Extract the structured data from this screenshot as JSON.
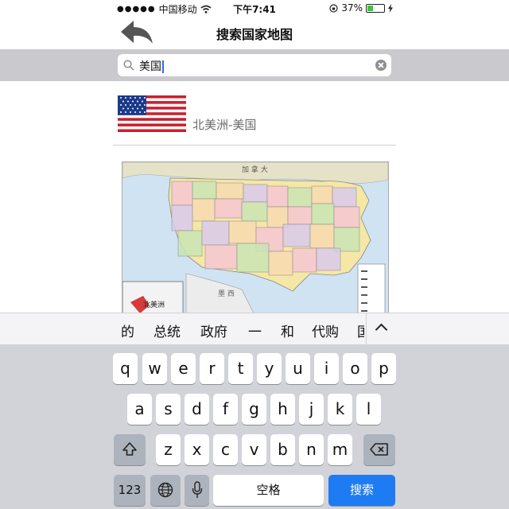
{
  "status": {
    "signal_dots": "●●●●●",
    "carrier": "中国移动",
    "time": "下午7:41",
    "battery": "37%",
    "battery_level": 0.37
  },
  "nav": {
    "title": "搜索国家地图"
  },
  "search": {
    "value": "美国"
  },
  "result": {
    "label": "北美洲-美国"
  },
  "map": {
    "labels": {
      "canada": "加 拿 大",
      "north_america": "北美洲",
      "mexico": "墨 西"
    }
  },
  "suggestions": [
    "的",
    "总统",
    "政府",
    "一",
    "和",
    "代购",
    "国"
  ],
  "keyboard": {
    "row1": [
      "q",
      "w",
      "e",
      "r",
      "t",
      "y",
      "u",
      "i",
      "o",
      "p"
    ],
    "row2": [
      "a",
      "s",
      "d",
      "f",
      "g",
      "h",
      "j",
      "k",
      "l"
    ],
    "row3": [
      "z",
      "x",
      "c",
      "v",
      "b",
      "n",
      "m"
    ],
    "num_label": "123",
    "space_label": "空格",
    "search_label": "搜索"
  },
  "colors": {
    "accent": "#1e7bf2",
    "battery": "#3ac63a"
  }
}
